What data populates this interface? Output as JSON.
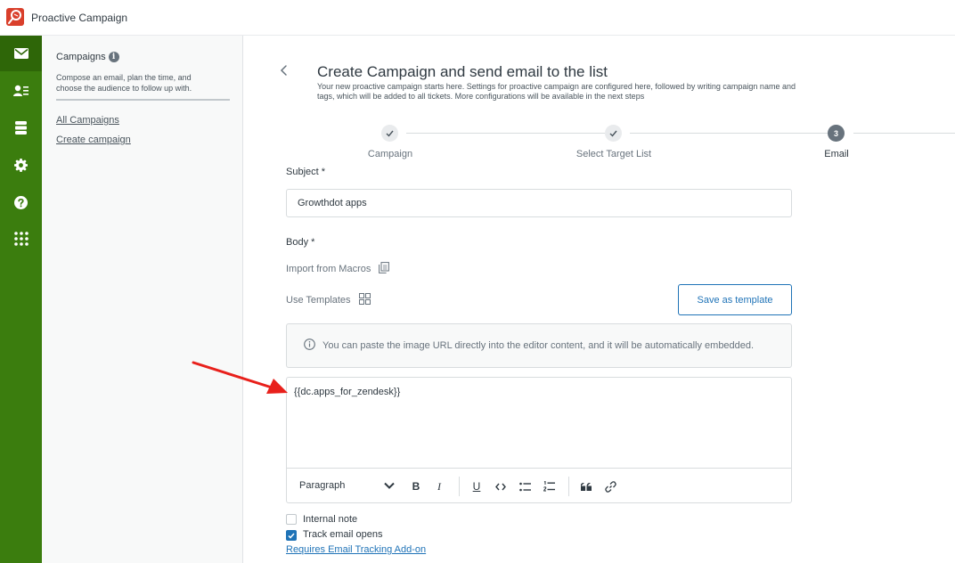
{
  "app": {
    "title": "Proactive Campaign"
  },
  "colors": {
    "brand": "#d93f2b",
    "nav": "#3b7d0e",
    "accent": "#1f73b7"
  },
  "nav": {
    "items": [
      {
        "icon": "mail-icon",
        "active": true
      },
      {
        "icon": "contact-list-icon",
        "active": false
      },
      {
        "icon": "database-icon",
        "active": false
      },
      {
        "icon": "gear-icon",
        "active": false
      },
      {
        "icon": "help-icon",
        "active": false
      },
      {
        "icon": "apps-grid-icon",
        "active": false
      }
    ]
  },
  "sidebar": {
    "title": "Campaigns",
    "info_glyph": "i",
    "description": "Compose an email, plan the time, and choose the audience to follow up with.",
    "links": [
      "All Campaigns",
      "Create campaign"
    ]
  },
  "header": {
    "title": "Create Campaign and send email to the list",
    "subtitle": "Your new proactive campaign starts here. Settings for proactive campaign are configured here, followed by writing campaign name and tags, which will be added to all tickets. More configurations will be available in the next steps"
  },
  "steps": [
    {
      "label": "Campaign",
      "state": "done"
    },
    {
      "label": "Select Target List",
      "state": "done"
    },
    {
      "label": "Email",
      "number": "3",
      "state": "current"
    }
  ],
  "form": {
    "subject_label": "Subject",
    "required_mark": "*",
    "subject_value": "Growthdot apps",
    "body_label": "Body",
    "import_macros": "Import from Macros",
    "use_templates": "Use Templates",
    "save_template": "Save as template",
    "notice": "You can paste the image URL directly into the editor content, and it will be automatically embedded.",
    "editor_content": "{{dc.apps_for_zendesk}}",
    "paragraph_select": "Paragraph",
    "toolbar_bold": "B",
    "toolbar_italic": "I",
    "toolbar_underline": "U",
    "internal_note": {
      "label": "Internal note",
      "checked": false
    },
    "track_opens": {
      "label": "Track email opens",
      "checked": true
    },
    "tracking_link": "Requires Email Tracking Add-on"
  },
  "annotation": {
    "arrow_color": "#e8201b"
  }
}
